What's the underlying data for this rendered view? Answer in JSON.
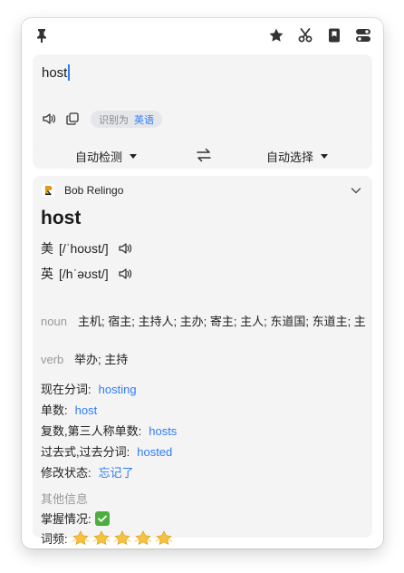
{
  "toolbar": {
    "left_icon": "pin-icon",
    "right_icons": [
      "star-icon",
      "scissors-icon",
      "bookmark-icon",
      "toggle-settings-icon"
    ]
  },
  "input": {
    "value": "host",
    "detected_prefix": "识别为",
    "detected_lang": "英语"
  },
  "lang_bar": {
    "source": "自动检测",
    "target": "自动选择"
  },
  "result": {
    "source_name": "Bob Relingo",
    "word": "host",
    "pronunciations": [
      {
        "region": "美",
        "phonetic": "[/ˈhoʊst/]"
      },
      {
        "region": "英",
        "phonetic": "[/hˈəʊst/]"
      }
    ],
    "definitions": [
      {
        "pos": "noun",
        "meaning": "主机; 宿主; 主持人; 主办; 寄主; 主人; 东道国; 东道主; 主"
      },
      {
        "pos": "verb",
        "meaning": "举办; 主持"
      }
    ],
    "forms": [
      {
        "label": "现在分词:",
        "value": "hosting"
      },
      {
        "label": "单数:",
        "value": "host"
      },
      {
        "label": "复数,第三人称单数:",
        "value": "hosts"
      },
      {
        "label": "过去式,过去分词:",
        "value": "hosted"
      },
      {
        "label": "修改状态:",
        "value": "忘记了"
      }
    ],
    "other_info_title": "其他信息",
    "mastery_label": "掌握情况:",
    "frequency_label": "词频:",
    "frequency_stars": 5
  },
  "colors": {
    "accent": "#2f7cf6",
    "panel": "#f4f4f5",
    "muted": "#999999",
    "check": "#4caf3d",
    "star": "#f5c242"
  }
}
